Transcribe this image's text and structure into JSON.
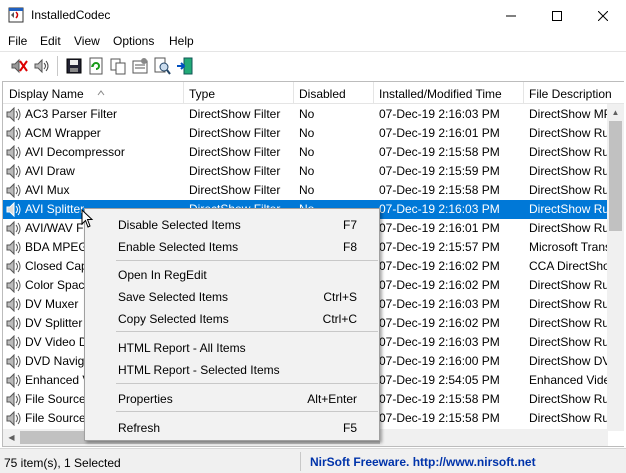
{
  "window": {
    "title": "InstalledCodec",
    "minimize_icon": "minimize-icon",
    "maximize_icon": "maximize-icon",
    "close_icon": "close-icon"
  },
  "menu": [
    "File",
    "Edit",
    "View",
    "Options",
    "Help"
  ],
  "toolbar": [
    "disable-icon",
    "enable-icon",
    "save-icon",
    "refresh-icon",
    "copy-icon",
    "properties-icon",
    "find-icon",
    "exit-icon"
  ],
  "columns": [
    "Display Name",
    "Type",
    "Disabled",
    "Installed/Modified Time",
    "File Description"
  ],
  "rows": [
    {
      "name": "AC3 Parser Filter",
      "type": "DirectShow Filter",
      "disabled": "No",
      "time": "07-Dec-19 2:16:03 PM",
      "desc": "DirectShow MP"
    },
    {
      "name": "ACM Wrapper",
      "type": "DirectShow Filter",
      "disabled": "No",
      "time": "07-Dec-19 2:16:01 PM",
      "desc": "DirectShow Ru"
    },
    {
      "name": "AVI Decompressor",
      "type": "DirectShow Filter",
      "disabled": "No",
      "time": "07-Dec-19 2:15:58 PM",
      "desc": "DirectShow Ru"
    },
    {
      "name": "AVI Draw",
      "type": "DirectShow Filter",
      "disabled": "No",
      "time": "07-Dec-19 2:15:59 PM",
      "desc": "DirectShow Ru"
    },
    {
      "name": "AVI Mux",
      "type": "DirectShow Filter",
      "disabled": "No",
      "time": "07-Dec-19 2:15:58 PM",
      "desc": "DirectShow Ru"
    },
    {
      "name": "AVI Splitter",
      "type": "DirectShow Filter",
      "disabled": "No",
      "time": "07-Dec-19 2:16:03 PM",
      "desc": "DirectShow Ru",
      "selected": true
    },
    {
      "name": "AVI/WAV Fi",
      "type": "",
      "disabled": "",
      "time": "07-Dec-19 2:16:01 PM",
      "desc": "DirectShow Ru"
    },
    {
      "name": "BDA MPEG",
      "type": "",
      "disabled": "",
      "time": "07-Dec-19 2:15:57 PM",
      "desc": "Microsoft Trans"
    },
    {
      "name": "Closed Cap",
      "type": "",
      "disabled": "",
      "time": "07-Dec-19 2:16:02 PM",
      "desc": "CCA DirectSho"
    },
    {
      "name": "Color Spac",
      "type": "",
      "disabled": "",
      "time": "07-Dec-19 2:16:02 PM",
      "desc": "DirectShow Ru"
    },
    {
      "name": "DV Muxer",
      "type": "",
      "disabled": "",
      "time": "07-Dec-19 2:16:03 PM",
      "desc": "DirectShow Ru"
    },
    {
      "name": "DV Splitter",
      "type": "",
      "disabled": "",
      "time": "07-Dec-19 2:16:02 PM",
      "desc": "DirectShow Ru"
    },
    {
      "name": "DV Video D",
      "type": "",
      "disabled": "",
      "time": "07-Dec-19 2:16:03 PM",
      "desc": "DirectShow Ru"
    },
    {
      "name": "DVD Navig",
      "type": "",
      "disabled": "",
      "time": "07-Dec-19 2:16:00 PM",
      "desc": "DirectShow DV"
    },
    {
      "name": "Enhanced V",
      "type": "",
      "disabled": "",
      "time": "07-Dec-19 2:54:05 PM",
      "desc": "Enhanced Vide"
    },
    {
      "name": "File Source",
      "type": "",
      "disabled": "",
      "time": "07-Dec-19 2:15:58 PM",
      "desc": "DirectShow Ru"
    },
    {
      "name": "File Source",
      "type": "",
      "disabled": "",
      "time": "07-Dec-19 2:15:58 PM",
      "desc": "DirectShow Ru"
    }
  ],
  "context_menu": [
    {
      "label": "Disable Selected Items",
      "key": "F7"
    },
    {
      "label": "Enable Selected Items",
      "key": "F8"
    },
    {
      "sep": true
    },
    {
      "label": "Open In RegEdit",
      "key": ""
    },
    {
      "label": "Save Selected Items",
      "key": "Ctrl+S"
    },
    {
      "label": "Copy Selected Items",
      "key": "Ctrl+C"
    },
    {
      "sep": true
    },
    {
      "label": "HTML Report - All Items",
      "key": ""
    },
    {
      "label": "HTML Report - Selected Items",
      "key": ""
    },
    {
      "sep": true
    },
    {
      "label": "Properties",
      "key": "Alt+Enter"
    },
    {
      "sep": true
    },
    {
      "label": "Refresh",
      "key": "F5"
    }
  ],
  "status": {
    "count": "75 item(s), 1 Selected",
    "link": "NirSoft Freeware.  http://www.nirsoft.net"
  },
  "colors": {
    "selection": "#0078d7",
    "link": "#0033aa"
  }
}
